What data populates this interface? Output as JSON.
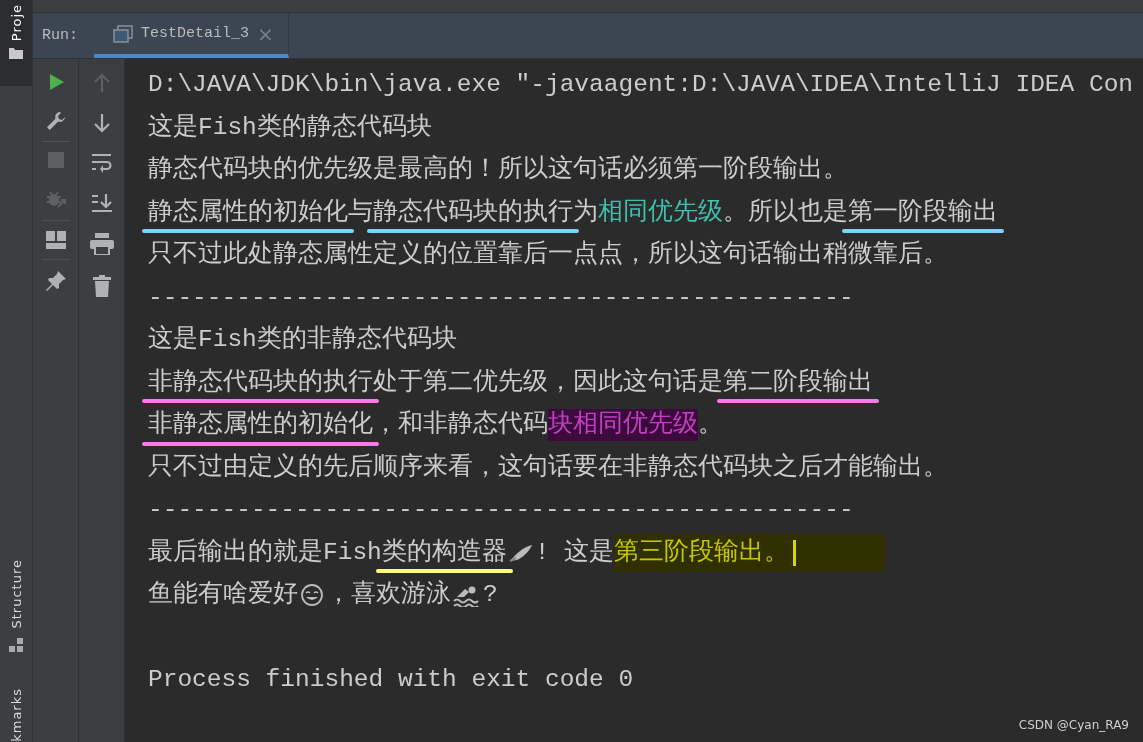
{
  "side_labels": {
    "top": "Proje",
    "middle": "Structure",
    "bottom": "kmarks"
  },
  "run_bar": {
    "label": "Run:",
    "tab": {
      "title": "TestDetail_3",
      "selected": true,
      "close": "×"
    }
  },
  "toolbar_main": [
    {
      "disabled": false
    },
    {
      "disabled": false
    },
    {
      "disabled": true
    },
    {
      "disabled": true
    },
    {
      "disabled": false
    },
    {
      "disabled": false
    }
  ],
  "toolbar_side": [
    {
      "disabled": true
    },
    {
      "disabled": false
    },
    {
      "disabled": false
    },
    {
      "disabled": false
    },
    {
      "disabled": false
    },
    {
      "disabled": false
    }
  ],
  "console": [
    {
      "kind": "text",
      "segments": [
        {
          "text": "D:\\JAVA\\JDK\\bin\\java.exe \"-javaagent:D:\\JAVA\\IDEA\\IntelliJ IDEA Con",
          "kind": "plain"
        }
      ]
    },
    {
      "kind": "text",
      "segments": [
        {
          "text": "这是Fish类的静态代码块",
          "kind": "plain"
        }
      ]
    },
    {
      "kind": "text",
      "segments": [
        {
          "text": "静态代码块的优先级是最高的！所以这句话必须第一阶段输出。",
          "kind": "plain"
        }
      ]
    },
    {
      "kind": "text",
      "segments": [
        {
          "text": "静态属性的初始化",
          "kind": "underlined",
          "color": "#7dd3fc"
        },
        {
          "text": "与",
          "kind": "plain"
        },
        {
          "text": "静态代码块的执行",
          "kind": "underlined",
          "color": "#7dd3fc"
        },
        {
          "text": "为",
          "kind": "plain"
        },
        {
          "text": "相同优先级",
          "kind": "teal"
        },
        {
          "text": "。所以也是",
          "kind": "plain"
        },
        {
          "text": "第一阶段输出",
          "kind": "underlined",
          "color": "#7dd3fc"
        }
      ]
    },
    {
      "kind": "text",
      "segments": [
        {
          "text": "只不过此处静态属性定义的位置靠后一点点，所以这句话输出稍微靠后。",
          "kind": "plain"
        }
      ]
    },
    {
      "kind": "text",
      "segments": [
        {
          "text": "------------------------------------------------",
          "kind": "plain"
        }
      ]
    },
    {
      "kind": "text",
      "segments": [
        {
          "text": "这是Fish类的非静态代码块",
          "kind": "plain"
        }
      ]
    },
    {
      "kind": "text",
      "segments": [
        {
          "text": "非静态代码块的执行",
          "kind": "underlined",
          "color": "#ff77e6"
        },
        {
          "text": "处于第二优先级，因此这句话是",
          "kind": "plain"
        },
        {
          "text": "第二阶段输出",
          "kind": "underlined",
          "color": "#ff77e6"
        }
      ]
    },
    {
      "kind": "text",
      "segments": [
        {
          "text": "非静态属性的初始化",
          "kind": "underlined",
          "color": "#ff77e6"
        },
        {
          "text": "，和非静态代码",
          "kind": "plain"
        },
        {
          "text": "块相同优先级",
          "kind": "magenta"
        },
        {
          "text": "。",
          "kind": "plain"
        }
      ]
    },
    {
      "kind": "text",
      "segments": [
        {
          "text": "只不过由定义的先后顺序来看，这句话要在非静态代码块之后才能输出。",
          "kind": "plain"
        }
      ]
    },
    {
      "kind": "text",
      "segments": [
        {
          "text": "------------------------------------------------",
          "kind": "plain"
        }
      ]
    },
    {
      "kind": "text",
      "cursor": true,
      "segments": [
        {
          "text": "最后输出的就是Fish",
          "kind": "plain"
        },
        {
          "text": "类的构造器",
          "kind": "underlined",
          "color": "#ffff77"
        },
        {
          "kind": "blade"
        },
        {
          "text": "! 这是",
          "kind": "plain"
        },
        {
          "text": "第三阶段输出。",
          "kind": "yellow"
        }
      ]
    },
    {
      "kind": "text",
      "segments": [
        {
          "text": "鱼能有啥爱好",
          "kind": "plain"
        },
        {
          "kind": "smiley"
        },
        {
          "text": "，喜欢游泳",
          "kind": "plain"
        },
        {
          "kind": "swimmer"
        },
        {
          "text": "?",
          "kind": "plain"
        }
      ]
    },
    {
      "kind": "blank"
    },
    {
      "kind": "text",
      "segments": [
        {
          "text": "Process finished with exit code 0",
          "kind": "plain"
        }
      ]
    }
  ],
  "watermark_text": "CSDN @Cyan_RA9"
}
